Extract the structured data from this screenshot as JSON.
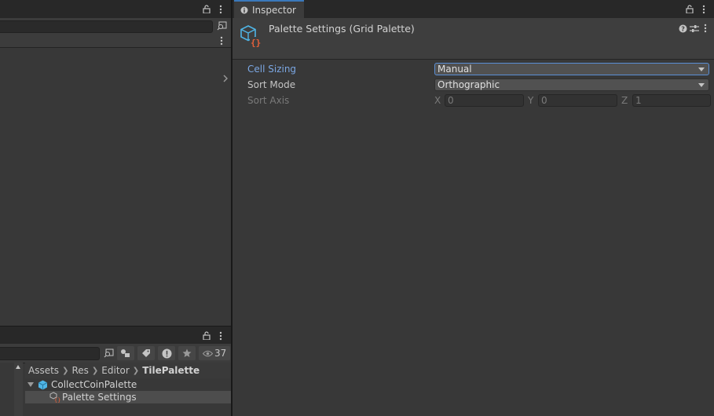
{
  "left_panel": {
    "lock_icon": "lock-icon",
    "menu_icon": "kebab-menu-icon",
    "expand_icon": "chevron-right-icon"
  },
  "project": {
    "hidden_count": "37",
    "breadcrumb": [
      "Assets",
      "Res",
      "Editor",
      "TilePalette"
    ],
    "tree": [
      {
        "label": "CollectCoinPalette",
        "icon": "prefab-cube-icon",
        "expanded": true
      },
      {
        "label": "Palette Settings",
        "icon": "scriptable-object-icon",
        "selected": true
      }
    ]
  },
  "inspector": {
    "tab_label": "Inspector",
    "title": "Palette Settings (Grid Palette)",
    "properties": {
      "cell_sizing": {
        "label": "Cell Sizing",
        "value": "Manual"
      },
      "sort_mode": {
        "label": "Sort Mode",
        "value": "Orthographic"
      },
      "sort_axis": {
        "label": "Sort Axis",
        "x_label": "X",
        "x": "0",
        "y_label": "Y",
        "y": "0",
        "z_label": "Z",
        "z": "1"
      }
    }
  },
  "colors": {
    "accent": "#3a79bb",
    "highlight_label": "#7ba7e3",
    "panel_bg": "#383838",
    "tabbar_bg": "#282828"
  }
}
